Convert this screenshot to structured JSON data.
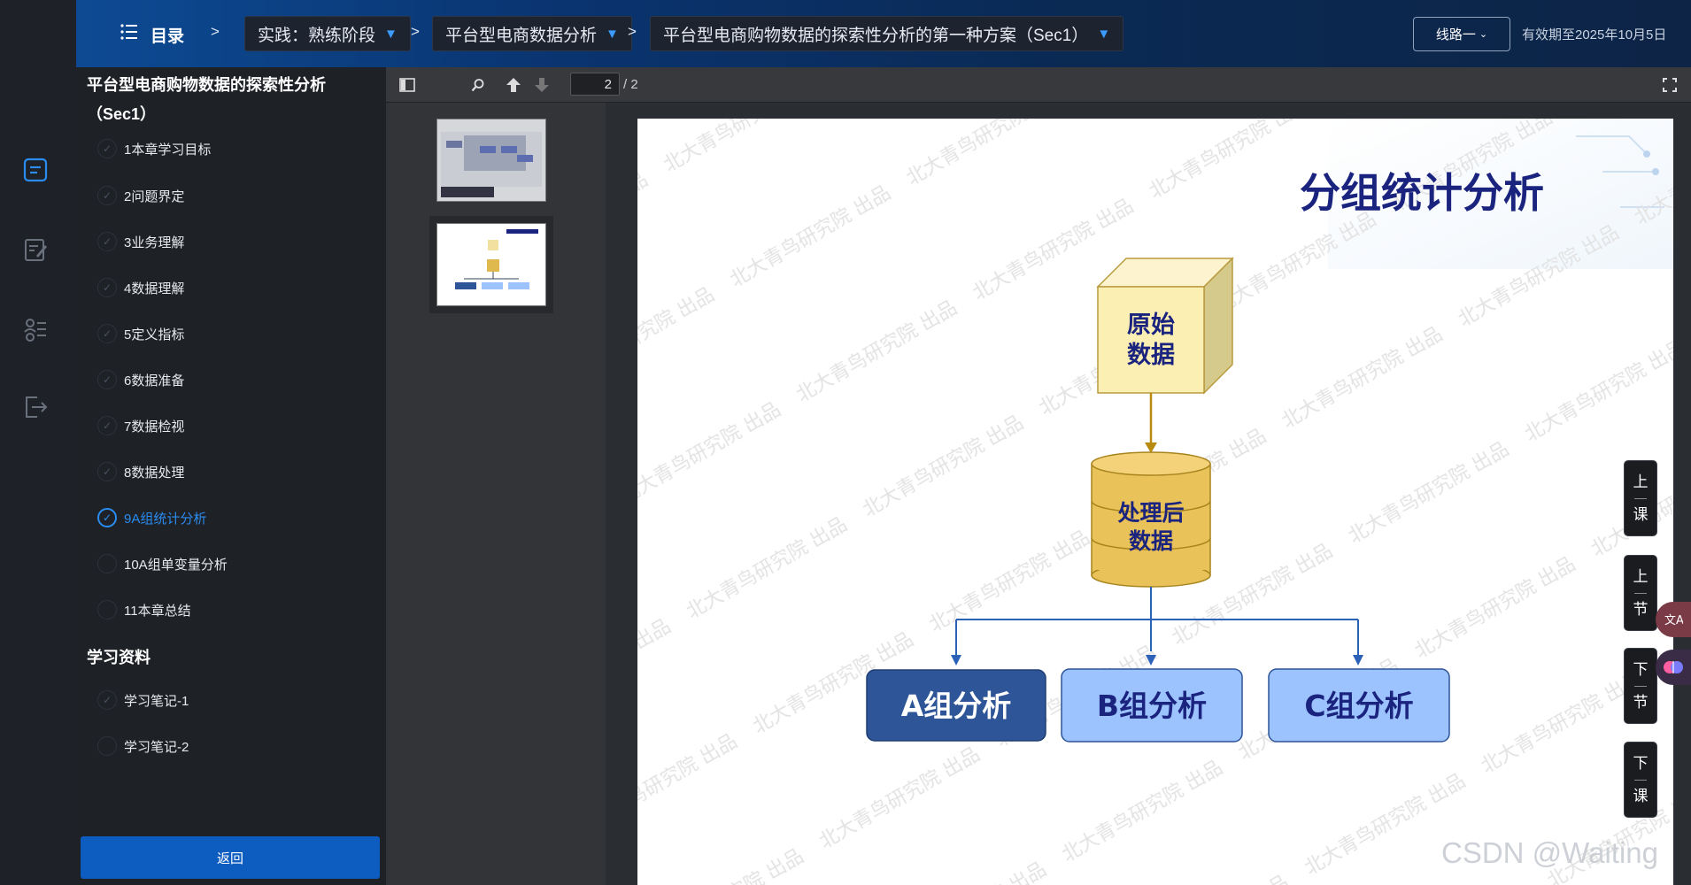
{
  "topbar": {
    "toc_label": "目录",
    "crumb_sep": ">",
    "crumbs": [
      "实践：熟练阶段",
      "平台型电商数据分析",
      "平台型电商购物数据的探索性分析的第一种方案（Sec1）"
    ],
    "route_button": "线路一",
    "expiry": "有效期至2025年10月5日"
  },
  "sidebar": {
    "course_title": "平台型电商购物数据的探索性分析（Sec1）",
    "chapters": [
      {
        "label": "1本章学习目标",
        "state": "done"
      },
      {
        "label": "2问题界定",
        "state": "done"
      },
      {
        "label": "3业务理解",
        "state": "done"
      },
      {
        "label": "4数据理解",
        "state": "done"
      },
      {
        "label": "5定义指标",
        "state": "done"
      },
      {
        "label": "6数据准备",
        "state": "done"
      },
      {
        "label": "7数据检视",
        "state": "done"
      },
      {
        "label": "8数据处理",
        "state": "done"
      },
      {
        "label": "9A组统计分析",
        "state": "active"
      },
      {
        "label": "10A组单变量分析",
        "state": "todo"
      },
      {
        "label": "11本章总结",
        "state": "todo"
      }
    ],
    "materials_heading": "学习资料",
    "materials": [
      {
        "label": "学习笔记-1",
        "state": "done"
      },
      {
        "label": "学习笔记-2",
        "state": "todo"
      }
    ],
    "back_button": "返回"
  },
  "viewer": {
    "current_page": "2",
    "total_pages": "/ 2"
  },
  "slide": {
    "title": "分组统计分析",
    "raw_data_line1": "原始",
    "raw_data_line2": "数据",
    "processed_line1": "处理后",
    "processed_line2": "数据",
    "groups": [
      "A组分析",
      "B组分析",
      "C组分析"
    ],
    "watermark": "北大青鸟研究院 出品"
  },
  "float_nav": {
    "prev_lesson": [
      "上",
      "课"
    ],
    "prev_section": [
      "上",
      "节"
    ],
    "next_section": [
      "下",
      "节"
    ],
    "next_lesson": [
      "下",
      "课"
    ]
  },
  "footer_watermark": "CSDN @Waiting",
  "colors": {
    "accent": "#2b8cf0",
    "topbar": "#0a3470",
    "slide_title": "#1a237e",
    "cube": "#fcefb4",
    "cylinder": "#e9c25a",
    "group_a": "#2d5597",
    "group_bc": "#9dc3ff"
  }
}
